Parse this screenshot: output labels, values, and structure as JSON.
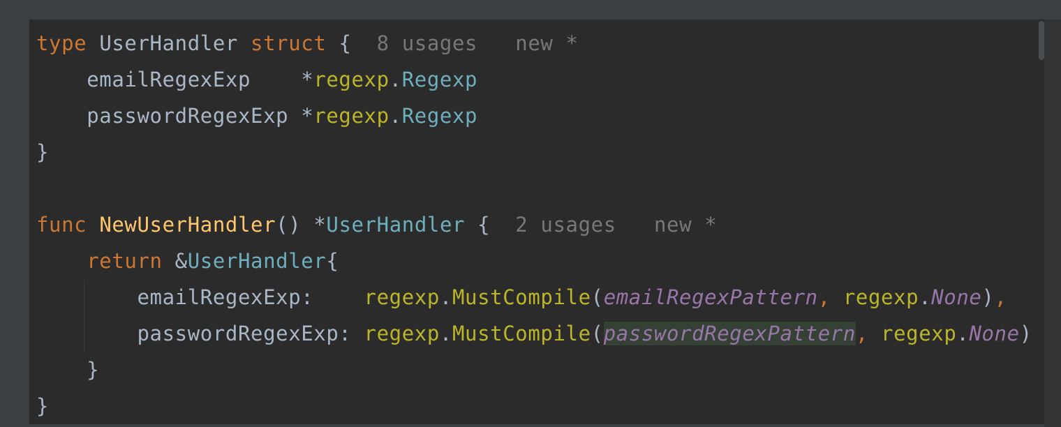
{
  "editor": {
    "lines": [
      {
        "tokens": [
          {
            "t": "type",
            "c": "kw"
          },
          {
            "t": " ",
            "c": "punc"
          },
          {
            "t": "UserHandler",
            "c": "field"
          },
          {
            "t": " ",
            "c": "punc"
          },
          {
            "t": "struct",
            "c": "kw"
          },
          {
            "t": " {",
            "c": "punc"
          },
          {
            "t": "  8 usages   new *",
            "c": "hint"
          }
        ]
      },
      {
        "tokens": [
          {
            "t": "    emailRegexExp    *",
            "c": "field"
          },
          {
            "t": "regexp",
            "c": "pkg"
          },
          {
            "t": ".",
            "c": "punc"
          },
          {
            "t": "Regexp",
            "c": "typ"
          }
        ]
      },
      {
        "tokens": [
          {
            "t": "    passwordRegexExp *",
            "c": "field"
          },
          {
            "t": "regexp",
            "c": "pkg"
          },
          {
            "t": ".",
            "c": "punc"
          },
          {
            "t": "Regexp",
            "c": "typ"
          }
        ]
      },
      {
        "tokens": [
          {
            "t": "}",
            "c": "punc"
          }
        ]
      },
      {
        "tokens": []
      },
      {
        "tokens": [
          {
            "t": "func",
            "c": "kw"
          },
          {
            "t": " ",
            "c": "punc"
          },
          {
            "t": "NewUserHandler",
            "c": "fn"
          },
          {
            "t": "() *",
            "c": "punc"
          },
          {
            "t": "UserHandler",
            "c": "typ"
          },
          {
            "t": " {",
            "c": "punc"
          },
          {
            "t": "  2 usages   new *",
            "c": "hint"
          }
        ]
      },
      {
        "tokens": [
          {
            "t": "    ",
            "c": "punc"
          },
          {
            "t": "return",
            "c": "kw"
          },
          {
            "t": " &",
            "c": "punc"
          },
          {
            "t": "UserHandler",
            "c": "typ"
          },
          {
            "t": "{",
            "c": "punc"
          }
        ]
      },
      {
        "tokens": [
          {
            "t": "        emailRegexExp:    ",
            "c": "field"
          },
          {
            "t": "regexp",
            "c": "pkg"
          },
          {
            "t": ".",
            "c": "punc"
          },
          {
            "t": "MustCompile",
            "c": "pkg"
          },
          {
            "t": "(",
            "c": "punc"
          },
          {
            "t": "emailRegexPattern",
            "c": "const"
          },
          {
            "t": ", ",
            "c": "kw"
          },
          {
            "t": "regexp",
            "c": "pkg"
          },
          {
            "t": ".",
            "c": "punc"
          },
          {
            "t": "None",
            "c": "const"
          },
          {
            "t": ")",
            "c": "punc"
          },
          {
            "t": ",",
            "c": "kw"
          }
        ]
      },
      {
        "tokens": [
          {
            "t": "        passwordRegexExp: ",
            "c": "field"
          },
          {
            "t": "regexp",
            "c": "pkg"
          },
          {
            "t": ".",
            "c": "punc"
          },
          {
            "t": "MustCompile",
            "c": "pkg"
          },
          {
            "t": "(",
            "c": "punc"
          },
          {
            "t": "passwordRegexPattern",
            "c": "const hl"
          },
          {
            "t": ", ",
            "c": "kw"
          },
          {
            "t": "regexp",
            "c": "pkg"
          },
          {
            "t": ".",
            "c": "punc"
          },
          {
            "t": "None",
            "c": "const"
          },
          {
            "t": ")",
            "c": "punc"
          }
        ]
      },
      {
        "tokens": [
          {
            "t": "    }",
            "c": "punc"
          }
        ]
      },
      {
        "tokens": [
          {
            "t": "}",
            "c": "punc"
          }
        ]
      }
    ]
  }
}
